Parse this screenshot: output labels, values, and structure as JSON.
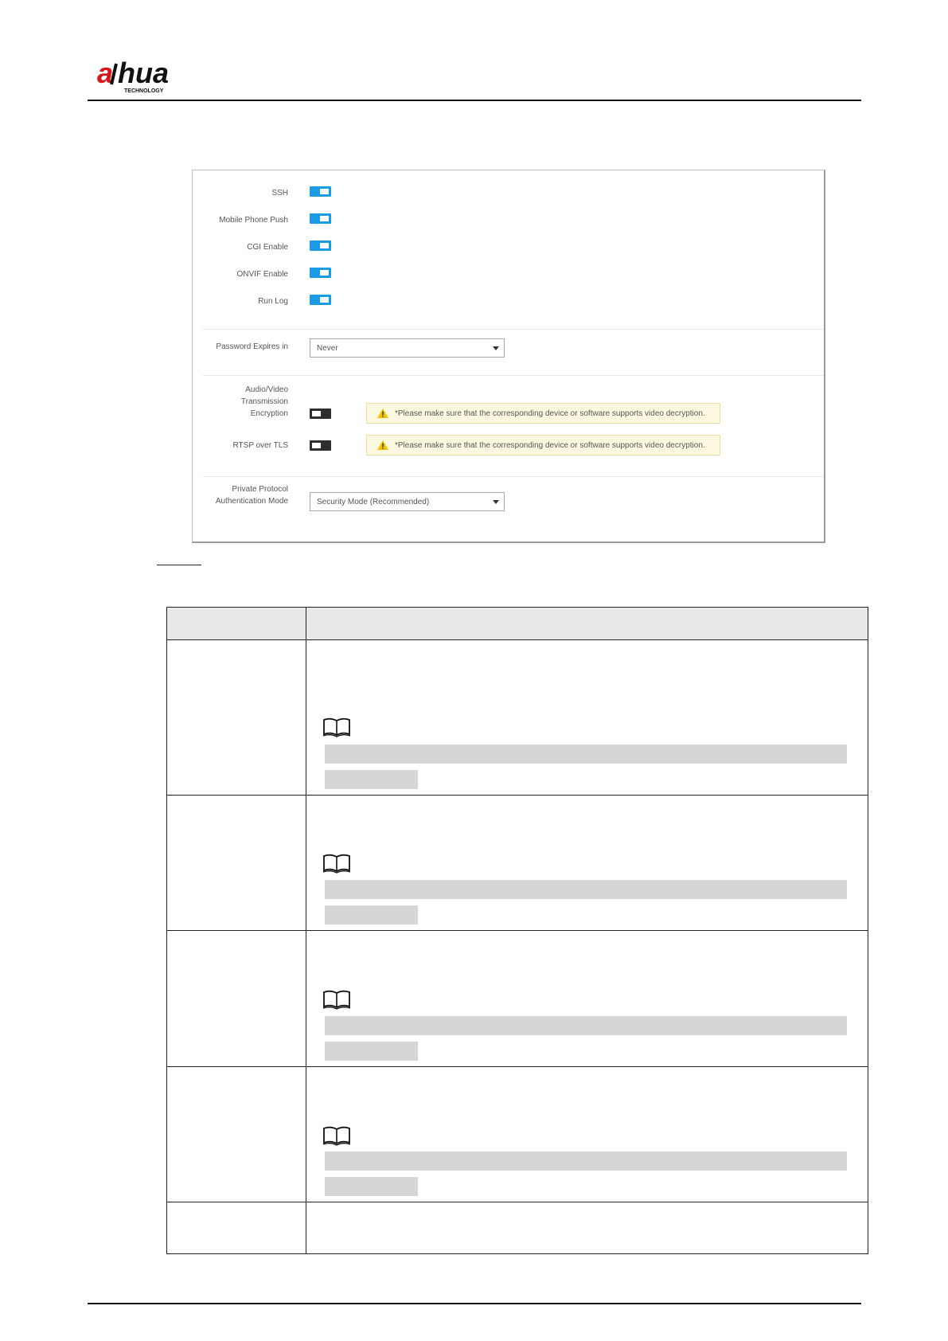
{
  "header": {
    "logo_text": "alhua",
    "logo_subtext": "TECHNOLOGY"
  },
  "settings": {
    "toggles": [
      {
        "label": "SSH",
        "state": "on"
      },
      {
        "label": "Mobile Phone Push",
        "state": "on"
      },
      {
        "label": "CGI Enable",
        "state": "on"
      },
      {
        "label": "ONVIF Enable",
        "state": "on"
      },
      {
        "label": "Run Log",
        "state": "on"
      }
    ],
    "password_expires": {
      "label": "Password Expires in",
      "value": "Never"
    },
    "av_encryption": {
      "label_line1": "Audio/Video",
      "label_line2": "Transmission",
      "label_line3": "Encryption",
      "state": "off",
      "warning": "*Please make sure that the corresponding device or software supports video decryption."
    },
    "rtsp_tls": {
      "label": "RTSP over TLS",
      "state": "off",
      "warning": "*Please make sure that the corresponding device or software supports video decryption."
    },
    "private_protocol": {
      "label_line1": "Private Protocol",
      "label_line2": "Authentication Mode",
      "value": "Security Mode (Recommended)"
    }
  },
  "colors": {
    "toggle_on": "#1a9be8",
    "toggle_off": "#2e2e2e",
    "warning_bg": "#fdf9e0",
    "warning_icon": "#f2c200",
    "redaction_bar": "#d6d6d6",
    "table_header_bg": "#e8e8e8"
  }
}
